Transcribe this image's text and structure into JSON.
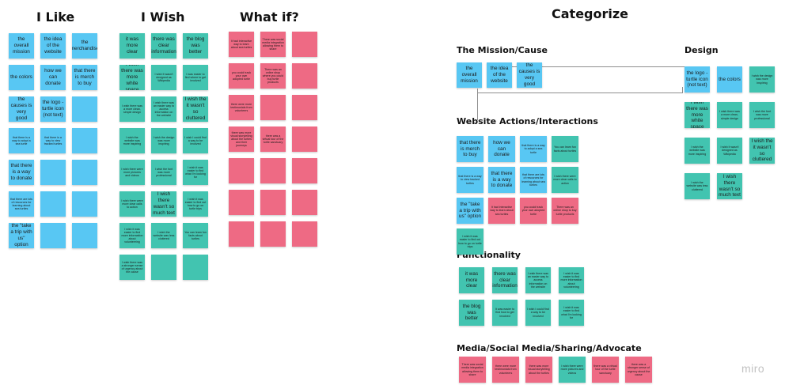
{
  "columns": {
    "like": {
      "title": "I Like",
      "notes": [
        "the overall mission",
        "the idea of the website",
        "the merchandise",
        "the colors",
        "how we can donate",
        "that there is merch to buy",
        "the causes is very good",
        "the logo - turtle icon (not text)",
        "",
        "that there is a way to adopt a sea turtle",
        "that there is a way to view tracked turtles",
        "",
        "that there is a way to donate",
        "",
        "",
        "that there are lots of resources for learning about sea turtles",
        "",
        "",
        "the \"take a trip with us\" option",
        "",
        ""
      ]
    },
    "wish": {
      "title": "I Wish",
      "notes": [
        "it was more clear",
        "there was clear information",
        "the blog was better",
        "I wish there was more white space",
        "I wish it wasn't designed as Wikipedia",
        "I was easier to find where to get involved",
        "I wish there was a more clean, simple design",
        "I wish there was an easier way to access information on the website",
        "I wish the it wasn't so cluttered",
        "I wish the website was more inspiring",
        "I wish the design was more inspiring",
        "I wish I could find a way to be involved",
        "I wish there were more pictures and videos",
        "I wish the font was more professional",
        "I wish it was easier to find what I'm looking for",
        "I wish there were more clear calls to action",
        "I wish there wasn't so much text",
        "I wish it was easier to find out how to go on turtle trips",
        "I wish it was easier to find more information about volunteering",
        "I wish the website was less cluttered",
        "You can learn fun facts about turtles",
        "I wish there was a stronger sense of urgency about the cause",
        "",
        ""
      ]
    },
    "whatif": {
      "title": "What if?",
      "notes": [
        "It had interactive way to learn about sea turtles",
        "There was social media integration allowing them to share",
        "",
        "you could track your own adopted turtle",
        "There was an online shop where you could buy turtle products",
        "",
        "there were more testimonials from volunteers",
        "",
        "",
        "there was more visual storytelling about the turtles and their journeys",
        "there was a virtual tour of the turtle sanctuary",
        "",
        "",
        "",
        "",
        "",
        "",
        "",
        "",
        "",
        ""
      ]
    }
  },
  "categorize": {
    "title": "Categorize",
    "mission": {
      "title": "The Mission/Cause",
      "notes": [
        "the overall mission",
        "the idea of the website",
        "the causes is very good"
      ]
    },
    "design": {
      "title": "Design",
      "notes": [
        "the logo - turtle icon (not text)",
        "the colors",
        "I wish the design was more inspiring",
        "I wish there was more white space",
        "I wish there was a more clean, simple design",
        "I wish the font was more professional",
        "I wish the website was more inspiring",
        "I wish it wasn't designed as Wikipedia",
        "I wish the it wasn't so cluttered",
        "I wish the website was less cluttered",
        "I wish there wasn't so much text"
      ]
    },
    "actions": {
      "title": "Website Actions/Interactions",
      "notes": [
        "that there is merch to buy",
        "how we can donate",
        "that there is a way to adopt a sea turtle",
        "You can learn fun facts about turtles",
        "that there is a way to view tracked turtles",
        "that there is a way to donate",
        "that there are lots of resources for learning about sea turtles",
        "I wish there were more clear calls to action",
        "the \"take a trip with us\" option",
        "It had interactive way to learn about sea turtles",
        "you could track your own adopted turtle",
        "There was an online shop to buy turtle products",
        "I wish it was easier to find out how to go on turtle trips"
      ]
    },
    "functionality": {
      "title": "Functionality",
      "notes": [
        "it was more clear",
        "there was clear information",
        "I wish there was an easier way to access information on the website",
        "I wish it was easier to find more information about volunteering",
        "the blog was better",
        "It was easier to find how to get involved",
        "I wish I could find a way to be involved",
        "I wish it was easier to find what I'm looking for"
      ]
    },
    "media": {
      "title": "Media/Social Media/Sharing/Advocate",
      "notes": [
        "There was social media integration allowing them to share",
        "there were more testimonials from volunteers",
        "there was more visual storytelling about the turtles",
        "I wish there were more pictures and videos",
        "there was a virtual tour of the turtle sanctuary",
        "there was a stronger sense of urgency about the cause"
      ]
    }
  },
  "brand": "miro"
}
